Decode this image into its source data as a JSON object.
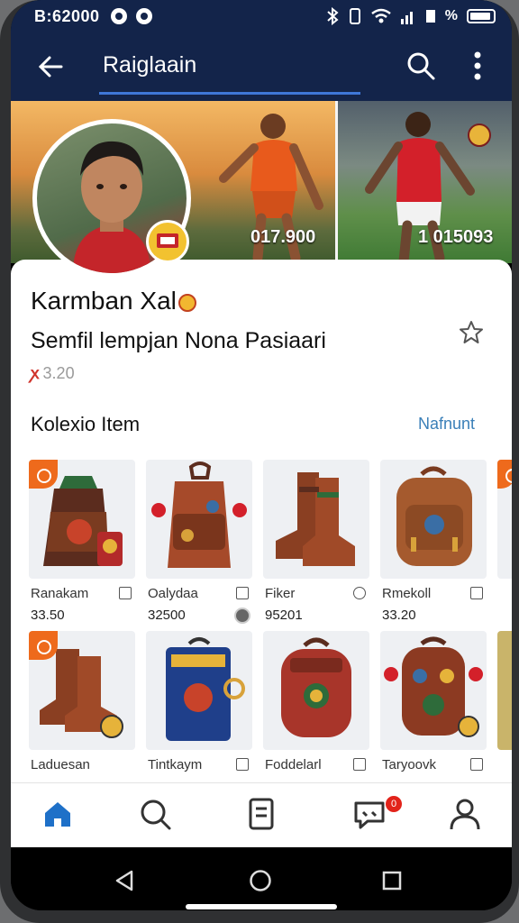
{
  "status_bar": {
    "time": "B:62000",
    "battery_pct": "%"
  },
  "app_bar": {
    "title": "Raiglaain"
  },
  "hero": {
    "stat_left": "017.900",
    "stat_right": "1 015093"
  },
  "profile": {
    "name": "Karmban Xal",
    "subtitle": "Semfil lempjan Nona Pasiaari",
    "rating": "3.20",
    "rating_icon": "ꭗ"
  },
  "collection": {
    "title": "Kolexio Item",
    "link": "Nafnunt",
    "items": [
      {
        "name": "Ranakam",
        "price": "33.50"
      },
      {
        "name": "Oalydaa",
        "price": "32500"
      },
      {
        "name": "Fiker",
        "price": "95201"
      },
      {
        "name": "Rmekoll",
        "price": "33.20"
      },
      {
        "name": "Laduesan",
        "price": ""
      },
      {
        "name": "Tintkaym",
        "price": ""
      },
      {
        "name": "Foddelarl",
        "price": ""
      },
      {
        "name": "Taryoovk",
        "price": ""
      }
    ]
  },
  "bottom_nav": {
    "messages_badge": "0"
  },
  "colors": {
    "header": "#13244a",
    "accent": "#3f77d8",
    "link": "#3a7fb8",
    "orange": "#ee6a1c"
  }
}
